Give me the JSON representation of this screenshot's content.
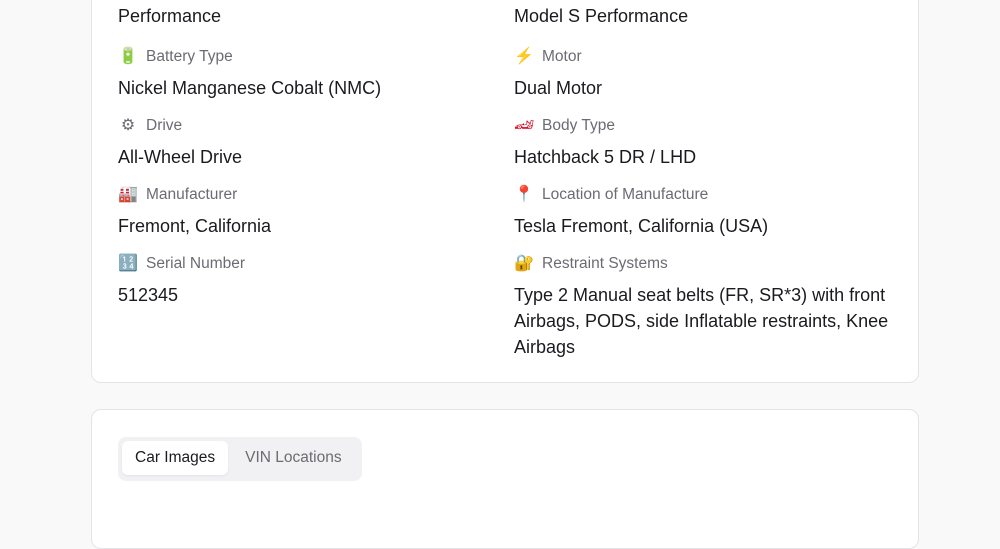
{
  "details": {
    "row0": {
      "left_value": "Performance",
      "right_value": "Model S Performance"
    },
    "fields": [
      {
        "icon": "battery-icon",
        "glyph": "🔋",
        "label": "Battery Type",
        "value": "Nickel Manganese Cobalt (NMC)"
      },
      {
        "icon": "lightning-icon",
        "glyph": "⚡",
        "label": "Motor",
        "value": "Dual Motor"
      },
      {
        "icon": "gear-icon",
        "glyph": "⚙",
        "label": "Drive",
        "value": "All-Wheel Drive"
      },
      {
        "icon": "race-car-icon",
        "glyph": "🏎",
        "label": "Body Type",
        "value": "Hatchback 5 DR / LHD"
      },
      {
        "icon": "factory-icon",
        "glyph": "🏭",
        "label": "Manufacturer",
        "value": "Fremont, California"
      },
      {
        "icon": "pin-icon",
        "glyph": "📍",
        "label": "Location of Manufacture",
        "value": "Tesla Fremont, California (USA)"
      },
      {
        "icon": "numbers-icon",
        "glyph": "🔢",
        "label": "Serial Number",
        "value": "512345"
      },
      {
        "icon": "lock-icon",
        "glyph": "🔐",
        "label": "Restraint Systems",
        "value": "Type 2 Manual seat belts (FR, SR*3) with front Airbags, PODS, side Inflatable restraints, Knee Airbags"
      }
    ]
  },
  "images": {
    "tabs": [
      {
        "label": "Car Images",
        "active": true
      },
      {
        "label": "VIN Locations",
        "active": false
      }
    ]
  }
}
